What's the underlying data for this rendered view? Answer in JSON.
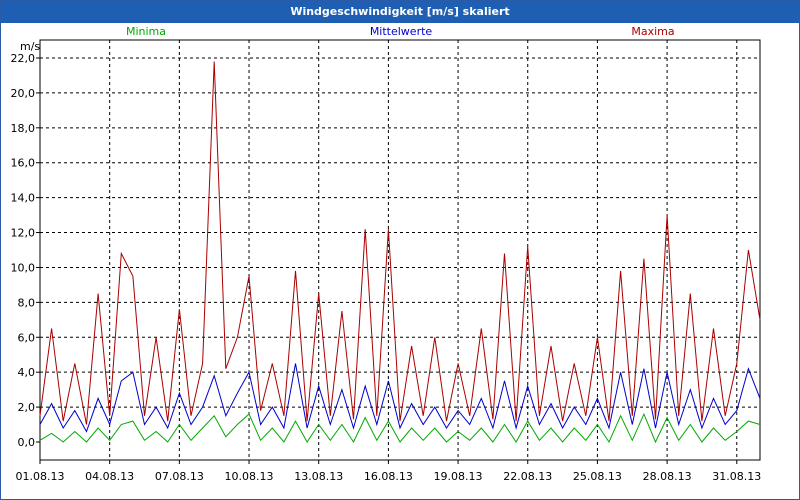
{
  "window": {
    "title": "Windgeschwindigkeit [m/s] skaliert"
  },
  "chart_data": {
    "type": "line",
    "title": "Windgeschwindigkeit [m/s] skaliert",
    "ylabel": "m/s",
    "xlabel": "",
    "ylim": [
      0,
      22
    ],
    "y_ticks": [
      "0,0",
      "2,0",
      "4,0",
      "6,0",
      "8,0",
      "10,0",
      "12,0",
      "14,0",
      "16,0",
      "18,0",
      "20,0",
      "22,0"
    ],
    "x_ticks": [
      "01.08.13",
      "04.08.13",
      "07.08.13",
      "10.08.13",
      "13.08.13",
      "16.08.13",
      "19.08.13",
      "22.08.13",
      "25.08.13",
      "28.08.13",
      "31.08.13"
    ],
    "x_range_days": [
      0,
      31
    ],
    "grid": true,
    "legend_position": "top",
    "legend": [
      {
        "label": "Minima",
        "color": "#00aa00"
      },
      {
        "label": "Mittelwerte",
        "color": "#0000cc"
      },
      {
        "label": "Maxima",
        "color": "#aa0000"
      }
    ],
    "series": [
      {
        "name": "Maxima",
        "color": "#aa0000",
        "x": [
          0,
          0.5,
          1,
          1.5,
          2,
          2.5,
          3,
          3.5,
          4,
          4.5,
          5,
          5.5,
          6,
          6.5,
          7,
          7.5,
          8,
          8.5,
          9,
          9.5,
          10,
          10.5,
          11,
          11.5,
          12,
          12.5,
          13,
          13.5,
          14,
          14.5,
          15,
          15.5,
          16,
          16.5,
          17,
          17.5,
          18,
          18.5,
          19,
          19.5,
          20,
          20.5,
          21,
          21.5,
          22,
          22.5,
          23,
          23.5,
          24,
          24.5,
          25,
          25.5,
          26,
          26.5,
          27,
          27.5,
          28,
          28.5,
          29,
          29.5,
          30,
          30.5,
          31
        ],
        "values": [
          1.5,
          6.5,
          1.2,
          4.5,
          1.0,
          8.5,
          1.5,
          10.8,
          9.5,
          1.5,
          6.0,
          1.2,
          7.6,
          1.5,
          4.5,
          21.8,
          4.2,
          6.0,
          9.5,
          1.8,
          4.5,
          1.5,
          9.8,
          1.2,
          8.5,
          1.5,
          7.5,
          1.3,
          12.2,
          1.5,
          12.2,
          1.2,
          5.5,
          1.5,
          6.0,
          1.2,
          4.5,
          1.5,
          6.5,
          1.3,
          10.8,
          1.2,
          11.2,
          1.5,
          5.5,
          1.2,
          4.5,
          1.5,
          6.0,
          1.2,
          9.8,
          1.5,
          10.5,
          1.3,
          13.0,
          1.5,
          8.5,
          1.2,
          6.5,
          1.5,
          4.5,
          11.0,
          7.0
        ]
      },
      {
        "name": "Mittelwerte",
        "color": "#0000cc",
        "x": [
          0,
          0.5,
          1,
          1.5,
          2,
          2.5,
          3,
          3.5,
          4,
          4.5,
          5,
          5.5,
          6,
          6.5,
          7,
          7.5,
          8,
          8.5,
          9,
          9.5,
          10,
          10.5,
          11,
          11.5,
          12,
          12.5,
          13,
          13.5,
          14,
          14.5,
          15,
          15.5,
          16,
          16.5,
          17,
          17.5,
          18,
          18.5,
          19,
          19.5,
          20,
          20.5,
          21,
          21.5,
          22,
          22.5,
          23,
          23.5,
          24,
          24.5,
          25,
          25.5,
          26,
          26.5,
          27,
          27.5,
          28,
          28.5,
          29,
          29.5,
          30,
          30.5,
          31
        ],
        "values": [
          1.0,
          2.2,
          0.8,
          1.8,
          0.6,
          2.5,
          1.0,
          3.5,
          4.0,
          1.0,
          2.0,
          0.8,
          2.8,
          1.0,
          2.0,
          3.8,
          1.5,
          2.8,
          4.0,
          1.0,
          2.0,
          0.8,
          4.5,
          0.8,
          3.2,
          1.0,
          3.0,
          0.8,
          3.2,
          1.0,
          3.5,
          0.8,
          2.2,
          1.0,
          2.0,
          0.8,
          1.8,
          1.0,
          2.5,
          0.8,
          3.5,
          0.8,
          3.2,
          1.0,
          2.2,
          0.8,
          2.0,
          1.0,
          2.5,
          0.8,
          4.0,
          1.0,
          4.2,
          0.8,
          4.0,
          1.0,
          3.0,
          0.8,
          2.5,
          1.0,
          1.8,
          4.2,
          2.5
        ]
      },
      {
        "name": "Minima",
        "color": "#00aa00",
        "x": [
          0,
          0.5,
          1,
          1.5,
          2,
          2.5,
          3,
          3.5,
          4,
          4.5,
          5,
          5.5,
          6,
          6.5,
          7,
          7.5,
          8,
          8.5,
          9,
          9.5,
          10,
          10.5,
          11,
          11.5,
          12,
          12.5,
          13,
          13.5,
          14,
          14.5,
          15,
          15.5,
          16,
          16.5,
          17,
          17.5,
          18,
          18.5,
          19,
          19.5,
          20,
          20.5,
          21,
          21.5,
          22,
          22.5,
          23,
          23.5,
          24,
          24.5,
          25,
          25.5,
          26,
          26.5,
          27,
          27.5,
          28,
          28.5,
          29,
          29.5,
          30,
          30.5,
          31
        ],
        "values": [
          0.1,
          0.5,
          0.0,
          0.6,
          0.0,
          0.8,
          0.1,
          1.0,
          1.2,
          0.1,
          0.6,
          0.0,
          1.0,
          0.1,
          0.8,
          1.5,
          0.3,
          1.0,
          1.6,
          0.1,
          0.8,
          0.0,
          1.2,
          0.0,
          1.0,
          0.1,
          1.0,
          0.0,
          1.4,
          0.1,
          1.2,
          0.0,
          0.8,
          0.1,
          0.8,
          0.0,
          0.6,
          0.1,
          0.8,
          0.0,
          1.0,
          0.0,
          1.2,
          0.1,
          0.8,
          0.0,
          0.8,
          0.1,
          1.0,
          0.0,
          1.5,
          0.1,
          1.6,
          0.0,
          1.4,
          0.1,
          1.0,
          0.0,
          0.8,
          0.1,
          0.6,
          1.2,
          1.0
        ]
      }
    ]
  }
}
